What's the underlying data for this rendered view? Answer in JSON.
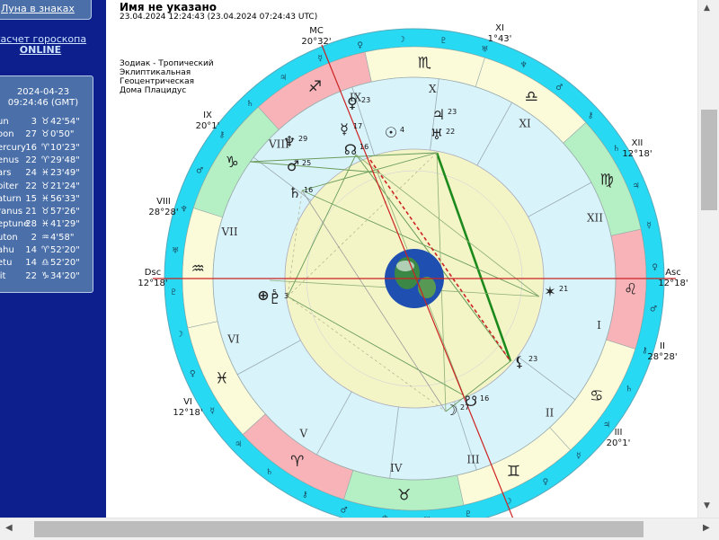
{
  "sidebar": {
    "moon_signs_link": "Луна в знаках",
    "horoscope_link_line1": "Расчет гороскопа",
    "horoscope_link_line2": "ONLINE",
    "date": "2024-04-23",
    "time": "09:24:46 (GMT)",
    "planets": [
      {
        "name": "un",
        "deg": "3",
        "sign_icon": "taurus",
        "min": "42'54\""
      },
      {
        "name": "oon",
        "deg": "27",
        "sign_icon": "taurus",
        "min": "0'50\""
      },
      {
        "name": "ercury",
        "deg": "16",
        "sign_icon": "aries",
        "min": "10'23\""
      },
      {
        "name": "enus",
        "deg": "22",
        "sign_icon": "aries",
        "min": "29'48\""
      },
      {
        "name": "ars",
        "deg": "24",
        "sign_icon": "pisces",
        "min": "23'49\""
      },
      {
        "name": "piter",
        "deg": "22",
        "sign_icon": "taurus",
        "min": "21'24\""
      },
      {
        "name": "aturn",
        "deg": "15",
        "sign_icon": "pisces",
        "min": "56'33\""
      },
      {
        "name": "ranus",
        "deg": "21",
        "sign_icon": "taurus",
        "min": "57'26\""
      },
      {
        "name": "eptune",
        "deg": "28",
        "sign_icon": "pisces",
        "min": "41'29\""
      },
      {
        "name": "uton",
        "deg": "2",
        "sign_icon": "aquarius",
        "min": "4'58\""
      },
      {
        "name": "ahu",
        "deg": "14",
        "sign_icon": "aries",
        "min": "52'20\""
      },
      {
        "name": "etu",
        "deg": "14",
        "sign_icon": "libra",
        "min": "52'20\""
      },
      {
        "name": "lit",
        "deg": "22",
        "sign_icon": "capricorn",
        "min": "34'20\""
      }
    ]
  },
  "main": {
    "title": "Имя не указано",
    "datetime": "23.04.2024 12:24:43 (23.04.2024 07:24:43 UTC)",
    "info": [
      "Зодиак - Тропический",
      "Эклиптикальная",
      "Геоцентрическая",
      "Дома Плацидус"
    ]
  },
  "chart": {
    "axes": [
      {
        "id": "asc",
        "name": "Asc",
        "value": "12°18'"
      },
      {
        "id": "dsc",
        "name": "Dsc",
        "value": "12°18'"
      },
      {
        "id": "mc",
        "name": "MC",
        "value": "20°32'"
      }
    ],
    "house_cusps": [
      {
        "id": "ii",
        "name": "II",
        "value": "28°28'"
      },
      {
        "id": "iii",
        "name": "III",
        "value": "20°1'"
      },
      {
        "id": "vi",
        "name": "VI",
        "value": "12°18'"
      },
      {
        "id": "viii",
        "name": "VIII",
        "value": "28°28'"
      },
      {
        "id": "ix",
        "name": "IX",
        "value": "20°1'"
      },
      {
        "id": "xi",
        "name": "XI",
        "value": "1°43'"
      },
      {
        "id": "xii",
        "name": "XII",
        "value": "12°18'"
      }
    ],
    "planet_labels": [
      {
        "id": "venus",
        "glyph": "♀",
        "deg": "23"
      },
      {
        "id": "mercury",
        "glyph": "☿",
        "deg": "17"
      },
      {
        "id": "north-node",
        "glyph": "☊",
        "deg": "16"
      },
      {
        "id": "sun",
        "glyph": "☉",
        "deg": "4"
      },
      {
        "id": "jupiter",
        "glyph": "♃",
        "deg": "23"
      },
      {
        "id": "uranus",
        "glyph": "♅",
        "deg": "22"
      },
      {
        "id": "neptune",
        "glyph": "♆",
        "deg": "29"
      },
      {
        "id": "mars",
        "glyph": "♂",
        "deg": "25"
      },
      {
        "id": "saturn",
        "glyph": "♄",
        "deg": "16"
      },
      {
        "id": "pluto",
        "glyph": "♇",
        "deg": "3"
      },
      {
        "id": "fortune",
        "glyph": "⊕",
        "deg": "5"
      },
      {
        "id": "vertex",
        "glyph": "✶",
        "deg": "21"
      },
      {
        "id": "lilith",
        "glyph": "⚸",
        "deg": "23"
      },
      {
        "id": "moon",
        "glyph": "☽",
        "deg": "27"
      },
      {
        "id": "south-node",
        "glyph": "☋",
        "deg": "16"
      }
    ],
    "colors": {
      "outer_ring": "#27d9f2",
      "zodiac_bg": "#fbfbd9",
      "fire": "#f7b3b7",
      "earth": "#b5f0c4",
      "inner_yellow": "#f3f5c6",
      "house_bg": "#d9f3fb",
      "axis_red": "#cc2222"
    }
  }
}
